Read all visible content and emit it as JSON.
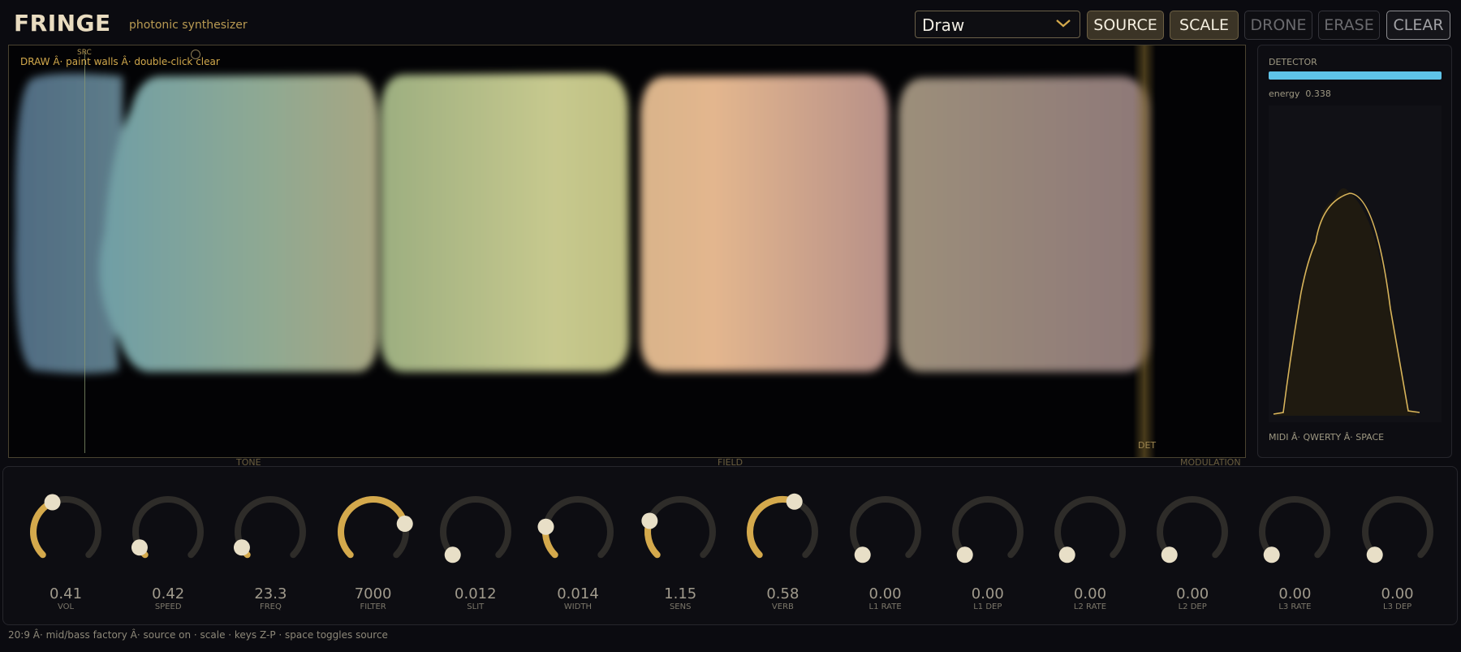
{
  "app": {
    "title": "FRINGE",
    "subtitle": "photonic synthesizer"
  },
  "toolbar": {
    "mode_value": "Draw",
    "buttons": [
      {
        "label": "SOURCE",
        "state": "on"
      },
      {
        "label": "SCALE",
        "state": "on"
      },
      {
        "label": "DRONE",
        "state": "off"
      },
      {
        "label": "ERASE",
        "state": "off"
      },
      {
        "label": "CLEAR",
        "state": "clear"
      }
    ]
  },
  "field": {
    "hint": "DRAW Â· paint walls  Â·  double-click clear",
    "src_label": "SRC",
    "det_label": "DET",
    "section_labels": [
      "TONE",
      "FIELD",
      "MODULATION"
    ]
  },
  "detector": {
    "title": "DETECTOR",
    "energy_label": "energy",
    "energy_value": "0.338",
    "energy_level": 1.0,
    "footer": "MIDI Â· QWERTY Â· SPACE",
    "bar_color": "#5fc4e8",
    "curve_color": "#d8b45a"
  },
  "knobs": [
    {
      "value": "0.41",
      "label": "VOL",
      "fill": 0.41
    },
    {
      "value": "0.42",
      "label": "SPEED",
      "fill": 0.06
    },
    {
      "value": "23.3",
      "label": "FREQ",
      "fill": 0.06
    },
    {
      "value": "7000",
      "label": "FILTER",
      "fill": 0.78
    },
    {
      "value": "0.012",
      "label": "SLIT",
      "fill": 0.0
    },
    {
      "value": "0.014",
      "label": "WIDTH",
      "fill": 0.2
    },
    {
      "value": "1.15",
      "label": "SENS",
      "fill": 0.24
    },
    {
      "value": "0.58",
      "label": "VERB",
      "fill": 0.58
    },
    {
      "value": "0.00",
      "label": "L1 RATE",
      "fill": 0.0
    },
    {
      "value": "0.00",
      "label": "L1 DEP",
      "fill": 0.0
    },
    {
      "value": "0.00",
      "label": "L2 RATE",
      "fill": 0.0
    },
    {
      "value": "0.00",
      "label": "L2 DEP",
      "fill": 0.0
    },
    {
      "value": "0.00",
      "label": "L3 RATE",
      "fill": 0.0
    },
    {
      "value": "0.00",
      "label": "L3 DEP",
      "fill": 0.0
    }
  ],
  "status": {
    "text": "20:9  Â·  mid/bass factory  Â·  source on  ·  scale  ·  keys Z-P · space toggles source"
  },
  "colors": {
    "accent": "#d4a94c",
    "knob_track": "#2e2c29",
    "knob_handle": "#e8dfc7"
  }
}
